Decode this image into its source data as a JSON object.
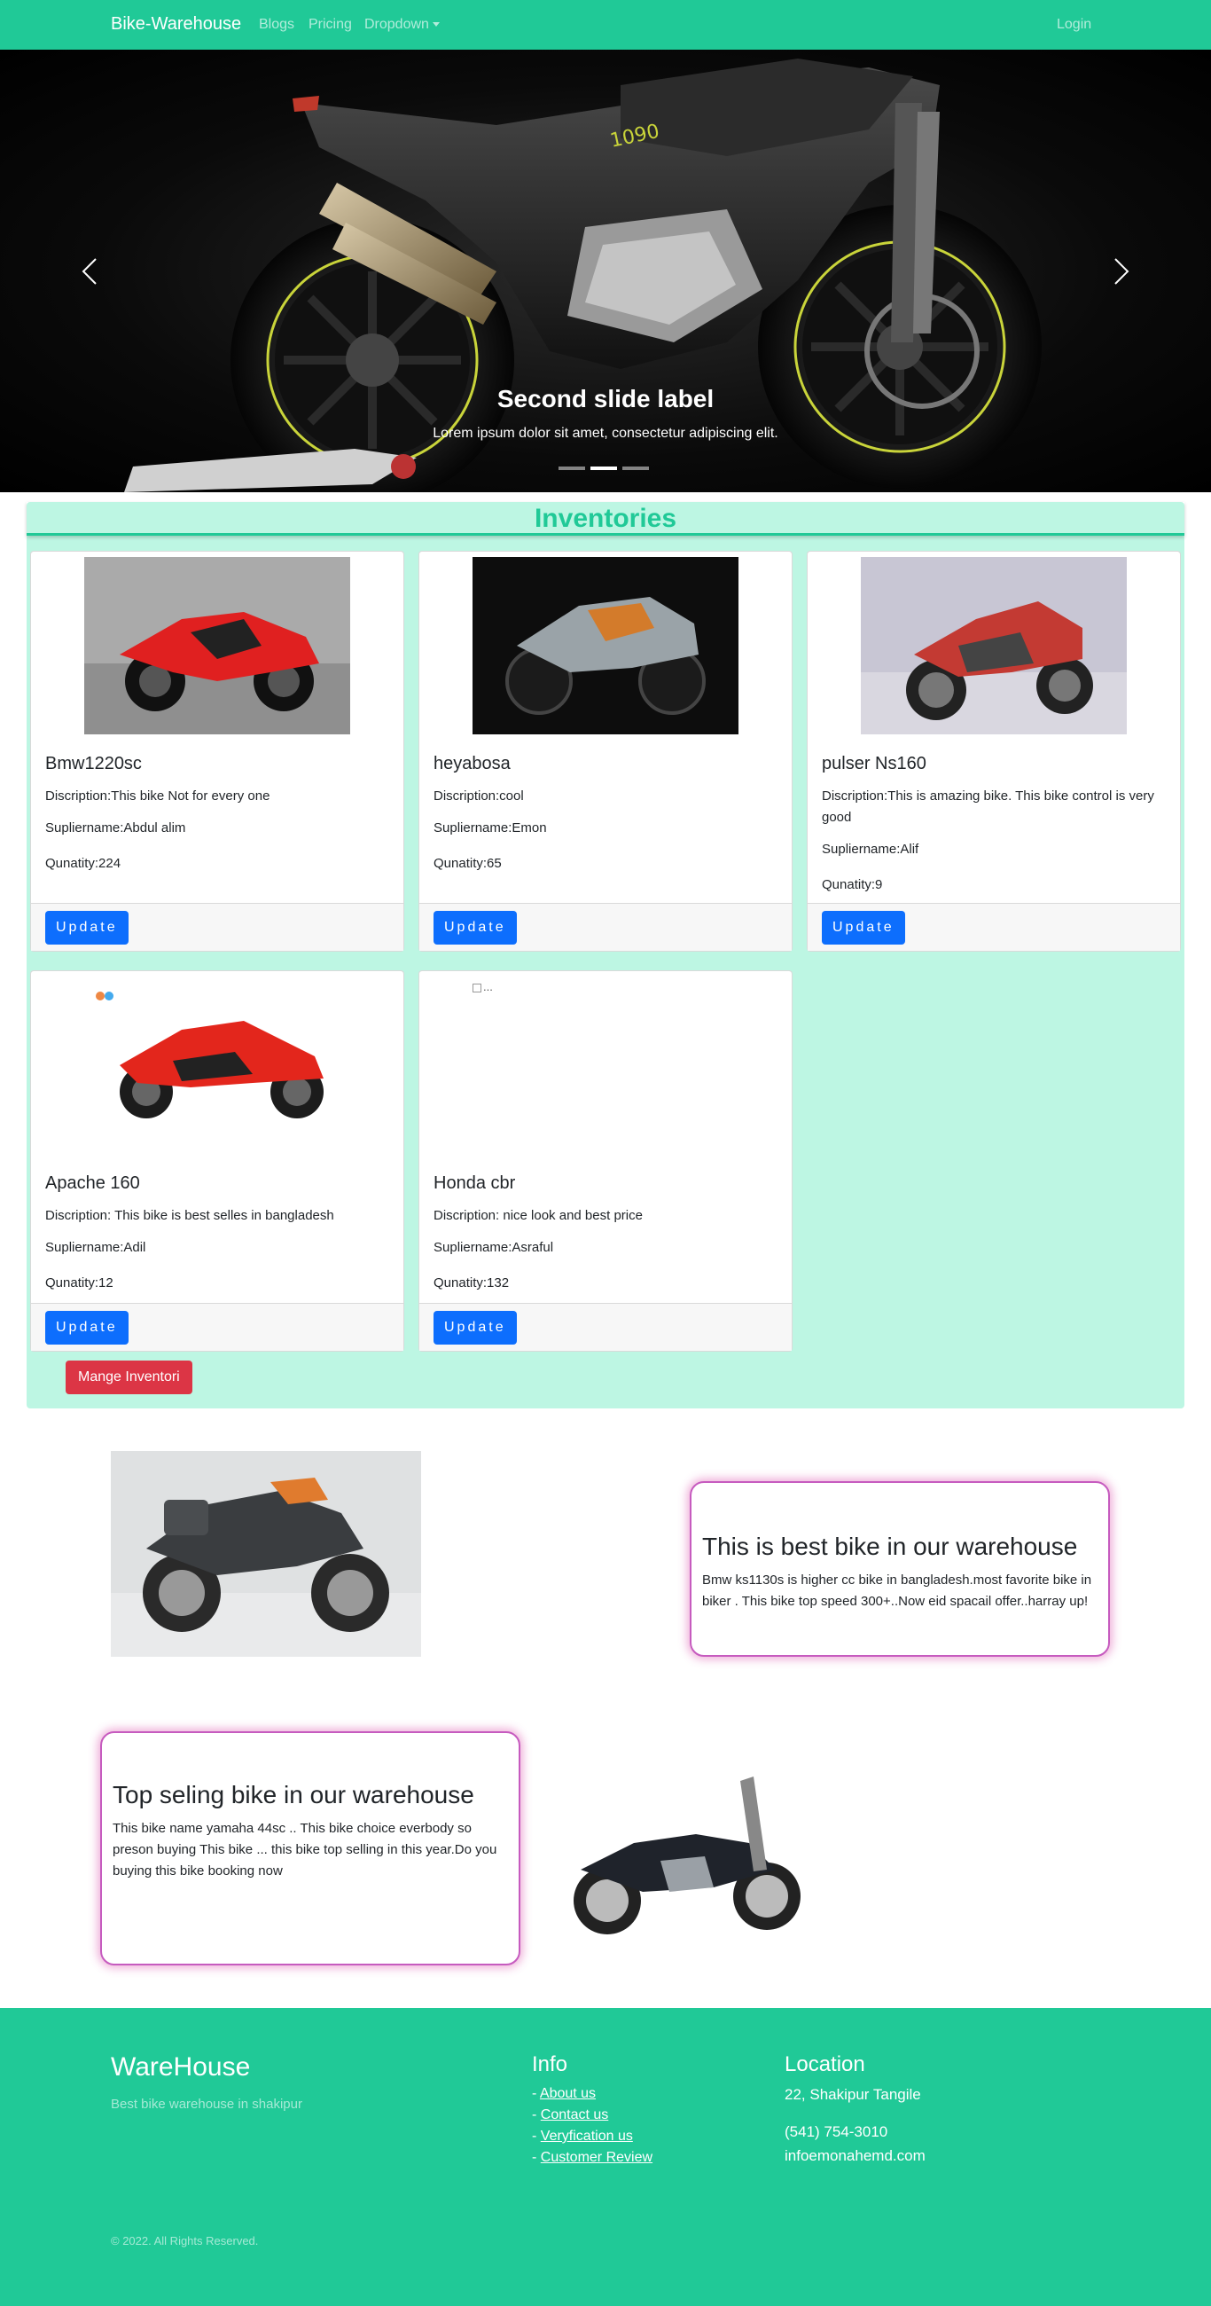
{
  "navbar": {
    "brand": "Bike-Warehouse",
    "links": [
      "Blogs",
      "Pricing",
      "Dropdown"
    ],
    "login": "Login"
  },
  "carousel": {
    "caption_title": "Second slide label",
    "caption_text": "Lorem ipsum dolor sit amet, consectetur adipiscing elit.",
    "indicators": 3,
    "active_indicator": 2
  },
  "inventory": {
    "title": "Inventories",
    "items": [
      {
        "name": "Bmw1220sc",
        "description": "Discription:This bike Not for every one",
        "supplier": "Supliername:Abdul alim",
        "quantity": "Qunatity:224",
        "button": "Update"
      },
      {
        "name": "heyabosa",
        "description": "Discription:cool",
        "supplier": "Supliername:Emon",
        "quantity": "Qunatity:65",
        "button": "Update"
      },
      {
        "name": "pulser Ns160",
        "description": "Discription:This is amazing bike. This bike control is very good",
        "supplier": "Supliername:Alif",
        "quantity": "Qunatity:9",
        "button": "Update"
      },
      {
        "name": "Apache 160",
        "description": "Discription: This bike is best selles in bangladesh",
        "supplier": "Supliername:Adil",
        "quantity": "Qunatity:12",
        "button": "Update"
      },
      {
        "name": "Honda cbr",
        "description": "Discription: nice look and best price",
        "supplier": "Supliername:Asraful",
        "quantity": "Qunatity:132",
        "button": "Update",
        "broken_image_alt": "..."
      }
    ],
    "manage_button": "Mange Inventori"
  },
  "feature1": {
    "title": "This is best bike in our warehouse",
    "text": "Bmw ks1130s is higher cc bike in bangladesh.most favorite bike in biker . This bike top speed 300+..Now eid spacail offer..harray up!"
  },
  "feature2": {
    "title": "Top seling bike in our warehouse",
    "text": "This bike name yamaha 44sc .. This bike choice everbody so preson buying This bike ... this bike top selling in this year.Do you buying this bike booking now"
  },
  "footer": {
    "brand": "WareHouse",
    "tagline": "Best bike warehouse in shakipur",
    "info_title": "Info",
    "info_links": [
      "About us",
      "Contact us",
      "Veryfication us",
      "Customer Review"
    ],
    "location_title": "Location",
    "address": "22, Shakipur Tangile",
    "phone": "(541) 754-3010",
    "email": "infoemonahemd.com",
    "copyright": "© 2022. All Rights Reserved."
  },
  "colors": {
    "primary": "#20c997",
    "inventory_bg": "#bdf6e3",
    "button_blue": "#0d6efd",
    "button_red": "#dc3545",
    "feature_border": "#c65bbf"
  }
}
